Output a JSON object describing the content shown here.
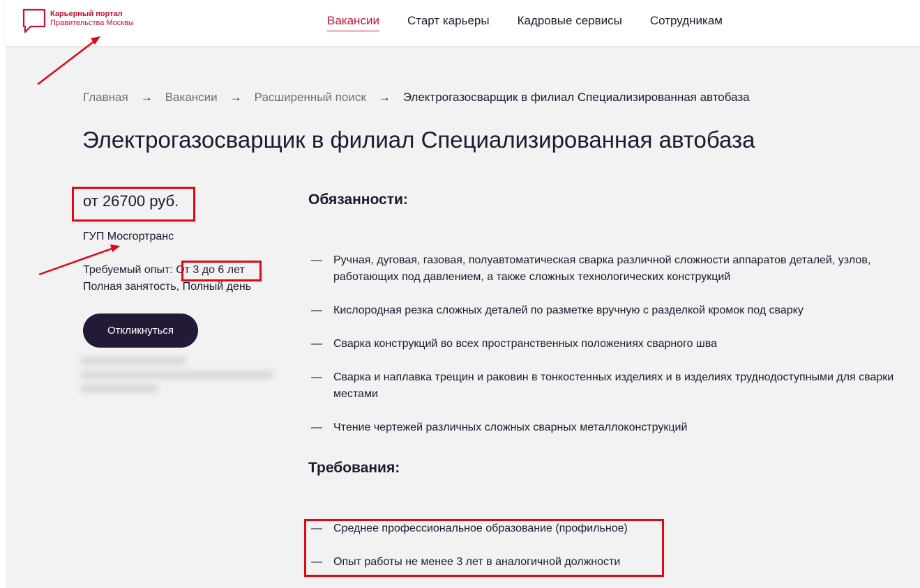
{
  "logo": {
    "line1": "Карьерный портал",
    "line2": "Правительства Москвы"
  },
  "nav": [
    {
      "label": "Вакансии",
      "active": true
    },
    {
      "label": "Старт карьеры",
      "active": false
    },
    {
      "label": "Кадровые сервисы",
      "active": false
    },
    {
      "label": "Сотрудникам",
      "active": false
    }
  ],
  "breadcrumb": {
    "items": [
      "Главная",
      "Вакансии",
      "Расширенный поиск",
      "Электрогазосварщик в филиал Специализированная автобаза"
    ],
    "separator": "→"
  },
  "vacancy": {
    "title": "Электрогазосварщик в филиал Специализированная автобаза",
    "salary": "от 26700 руб.",
    "company": "ГУП Мосгортранс",
    "experience_label": "Требуемый опыт: ",
    "experience_value": "От 3 до 6 лет",
    "employment": "Полная занятость, Полный день",
    "apply_label": "Откликнуться"
  },
  "duties": {
    "title": "Обязанности:",
    "items": [
      "Ручная, дуговая, газовая, полуавтоматическая сварка различной сложности аппаратов деталей, узлов, работающих под давлением, а также сложных технологических конструкций",
      "Кислородная резка сложных деталей по разметке вручную с разделкой кромок под сварку",
      "Сварка конструкций во всех пространственных положениях сварного шва",
      "Сварка и наплавка трещин и раковин в тонкостенных изделиях и в изделиях труднодоступными для сварки местами",
      "Чтение чертежей различных сложных сварных металлоконструкций"
    ]
  },
  "requirements": {
    "title": "Требования:",
    "items": [
      "Среднее профессиональное образование (профильное)",
      "Опыт работы не менее 3 лет в аналогичной должности"
    ]
  },
  "colors": {
    "brand_red": "#c8102e",
    "button_dark": "#231a35",
    "annotation_red": "#e30613",
    "background": "#f2f2f2"
  },
  "dash": "—"
}
